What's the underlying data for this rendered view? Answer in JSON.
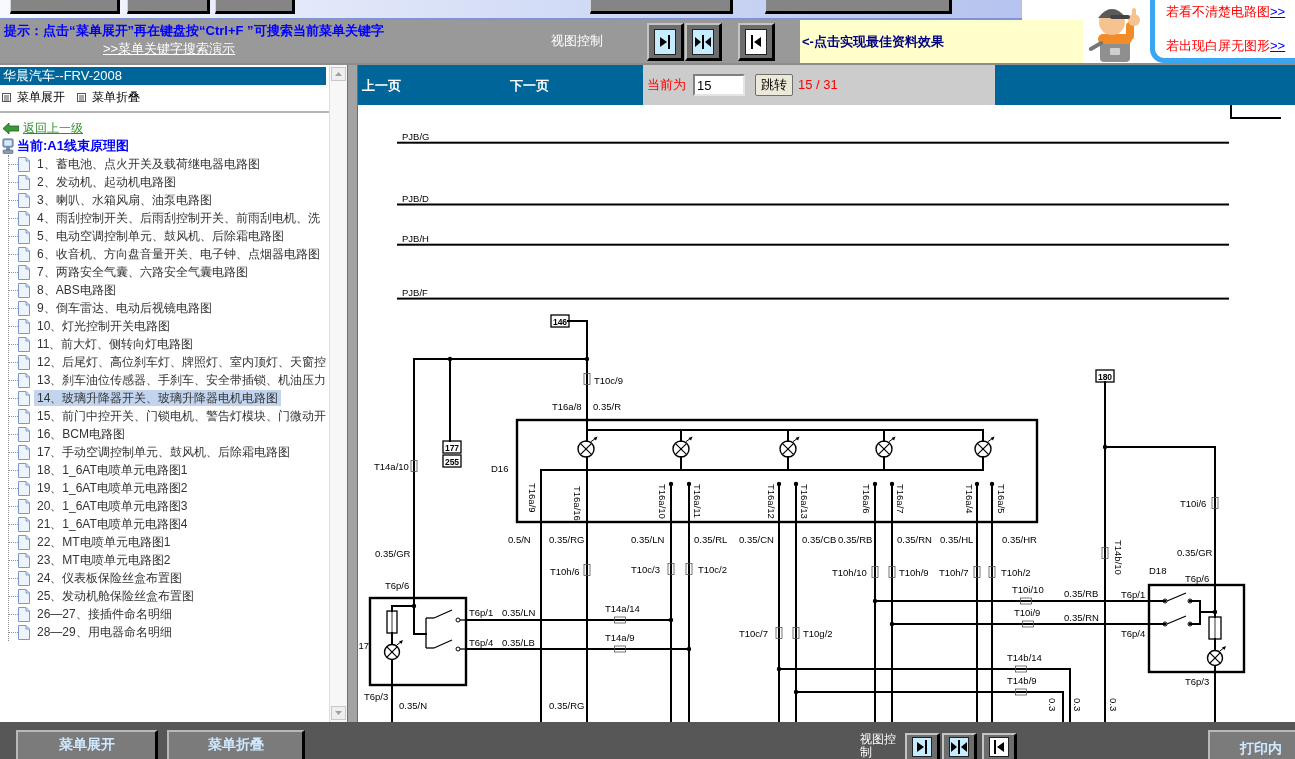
{
  "top_bar": {
    "hint": "提示：点击“菜单展开”再在键盘按“Ctrl+F ”可搜索当前菜单关键字",
    "demo_link": ">>菜单关键字搜索演示",
    "view_label": "视图控制",
    "view_buttons": [
      {
        "kind": "arrow_right_bar",
        "on": true
      },
      {
        "kind": "arrows_inward",
        "on": true
      },
      {
        "kind": "bar_arrow_left",
        "on": false
      }
    ],
    "notice": "<-点击实现最佳资料效果"
  },
  "help_panel": {
    "lines": [
      {
        "text": "若看不清楚电路图",
        "link": ">>"
      },
      {
        "text": "若出现白屏无图形",
        "link": ">>"
      }
    ]
  },
  "sidebar": {
    "title": "华晨汽车--FRV-2008",
    "actions": [
      "菜单展开",
      "菜单折叠"
    ],
    "back_link": "返回上一级",
    "current": "当前:A1线束原理图",
    "items": [
      {
        "label": "1、蓄电池、点火开关及载荷继电器电路图",
        "selected": false
      },
      {
        "label": "2、发动机、起动机电路图",
        "selected": false
      },
      {
        "label": "3、喇叭、水箱风扇、油泵电路图",
        "selected": false
      },
      {
        "label": "4、雨刮控制开关、后雨刮控制开关、前雨刮电机、洗",
        "selected": false
      },
      {
        "label": "5、电动空调控制单元、鼓风机、后除霜电路图",
        "selected": false
      },
      {
        "label": "6、收音机、方向盘音量开关、电子钟、点烟器电路图",
        "selected": false
      },
      {
        "label": "7、两路安全气囊、六路安全气囊电路图",
        "selected": false
      },
      {
        "label": "8、ABS电路图",
        "selected": false
      },
      {
        "label": "9、倒车雷达、电动后视镜电路图",
        "selected": false
      },
      {
        "label": "10、灯光控制开关电路图",
        "selected": false
      },
      {
        "label": "11、前大灯、侧转向灯电路图",
        "selected": false
      },
      {
        "label": "12、后尾灯、高位刹车灯、牌照灯、室内顶灯、天窗控",
        "selected": false
      },
      {
        "label": "13、刹车油位传感器、手刹车、安全带插锁、机油压力",
        "selected": false
      },
      {
        "label": "14、玻璃升降器开关、玻璃升降器电机电路图",
        "selected": true
      },
      {
        "label": "15、前门中控开关、门锁电机、警告灯模块、门微动开",
        "selected": false
      },
      {
        "label": "16、BCM电路图",
        "selected": false
      },
      {
        "label": "17、手动空调控制单元、鼓风机、后除霜电路图",
        "selected": false
      },
      {
        "label": "18、1_6AT电喷单元电路图1",
        "selected": false
      },
      {
        "label": "19、1_6AT电喷单元电路图2",
        "selected": false
      },
      {
        "label": "20、1_6AT电喷单元电路图3",
        "selected": false
      },
      {
        "label": "21、1_6AT电喷单元电路图4",
        "selected": false
      },
      {
        "label": "22、MT电喷单元电路图1",
        "selected": false
      },
      {
        "label": "23、MT电喷单元电路图2",
        "selected": false
      },
      {
        "label": "24、仪表板保险丝盒布置图",
        "selected": false
      },
      {
        "label": "25、发动机舱保险丝盒布置图",
        "selected": false
      },
      {
        "label": "26—27、接插件命名明细",
        "selected": false
      },
      {
        "label": "28—29、用电器命名明细",
        "selected": false
      }
    ]
  },
  "viewer": {
    "prev": "上一页",
    "next": "下一页",
    "page_label": "当前为",
    "page_value": "15",
    "go_button": "跳转",
    "page_count": "15 / 31"
  },
  "diagram": {
    "bus_labels": [
      "PJB/G",
      "PJB/D",
      "PJB/H",
      "PJB/F"
    ],
    "terminal_tags": [
      "146",
      "180",
      "177",
      "255"
    ],
    "module_labels": [
      "D16",
      "D18",
      "17"
    ],
    "pin_labels": [
      "T16a/9",
      "T16a/16",
      "T16a/10",
      "T16a/11",
      "T16a/12",
      "T16a/13",
      "T16a/6",
      "T16a/7",
      "T16a/4",
      "T16a/5",
      "T14b/10"
    ],
    "connector_labels": [
      "T10c/9",
      "T16a/8",
      "T14a/10",
      "T10i/6",
      "T10h/6",
      "T10c/3",
      "T10c/2",
      "T10h/10",
      "T10h/9",
      "T10h/7",
      "T10h/2",
      "T6p/6",
      "T6p/6",
      "T10i/10",
      "T6p/1",
      "T6p/1",
      "T14a/14",
      "T10i/9",
      "T6p/4",
      "T14a/9",
      "T10c/7",
      "T10g/2",
      "T6p/4",
      "T14b/14",
      "T14b/9",
      "T6p/3",
      "T6p/3"
    ],
    "wire_labels": [
      "0.35/R",
      "0.5/N",
      "0.35/RG",
      "0.35/LN",
      "0.35/RL",
      "0.35/CN",
      "0.35/CB",
      "0.35/RB",
      "0.35/RN",
      "0.35/HL",
      "0.35/HR",
      "0.35/GR",
      "0.35/GR",
      "0.35/RB",
      "0.35/LN",
      "0.35/RN",
      "0.35/LB",
      "0.35/N",
      "0.35/RG"
    ],
    "cut_labels": [
      "0.3",
      "0.3",
      "0.3"
    ]
  },
  "bottom_bar": {
    "buttons": [
      "菜单展开",
      "菜单折叠"
    ],
    "view_label": "视图控制",
    "view_buttons": [
      {
        "kind": "arrow_right_bar",
        "on": true
      },
      {
        "kind": "arrows_inward",
        "on": true
      },
      {
        "kind": "bar_arrow_left",
        "on": false
      }
    ],
    "print_button": "打印内"
  }
}
